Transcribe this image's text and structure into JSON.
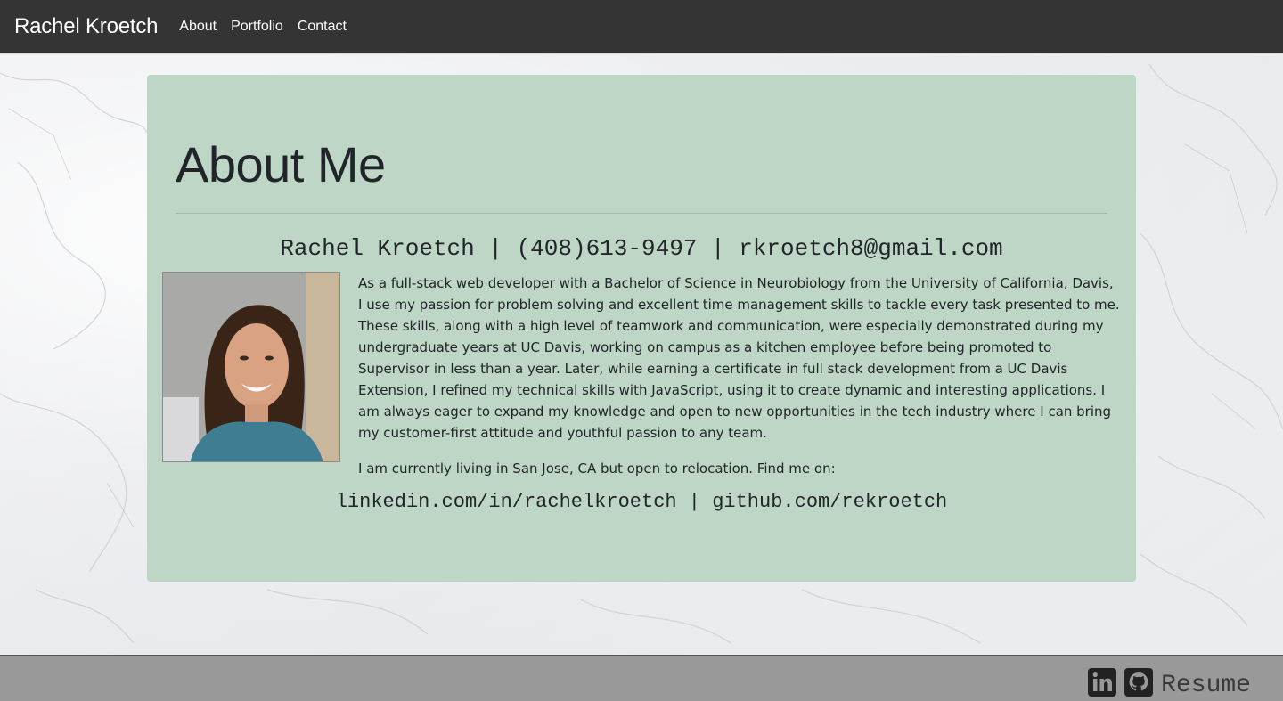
{
  "nav": {
    "brand": "Rachel Kroetch",
    "links": [
      "About",
      "Portfolio",
      "Contact"
    ]
  },
  "about": {
    "title": "About Me",
    "contact_line": "Rachel Kroetch | (408)613-9497 | rkroetch8@gmail.com",
    "bio": "As a full-stack web developer with a Bachelor of Science in Neurobiology from the University of California, Davis, I use my passion for problem solving and excellent time management skills to tackle every task presented to me. These skills, along with a high level of teamwork and communication, were especially demonstrated during my undergraduate years at UC Davis, working on campus as a kitchen employee before being promoted to Supervisor in less than a year. Later, while earning a certificate in full stack development from a UC Davis Extension, I refined my technical skills with JavaScript, using it to create dynamic and interesting applications. I am always eager to expand my knowledge and open to new opportunities in the tech industry where I can bring my customer-first attitude and youthful passion to any team.",
    "location": "I am currently living in San Jose, CA but open to relocation. Find me on:",
    "links_line": "linkedin.com/in/rachelkroetch | github.com/rekroetch",
    "photo_icon": "profile-photo"
  },
  "footer": {
    "icons": [
      "linkedin-icon",
      "github-icon"
    ],
    "resume_label": "Resume"
  },
  "colors": {
    "navbar": "#343434",
    "card": "#bdd6c6",
    "footer": "#999999"
  }
}
